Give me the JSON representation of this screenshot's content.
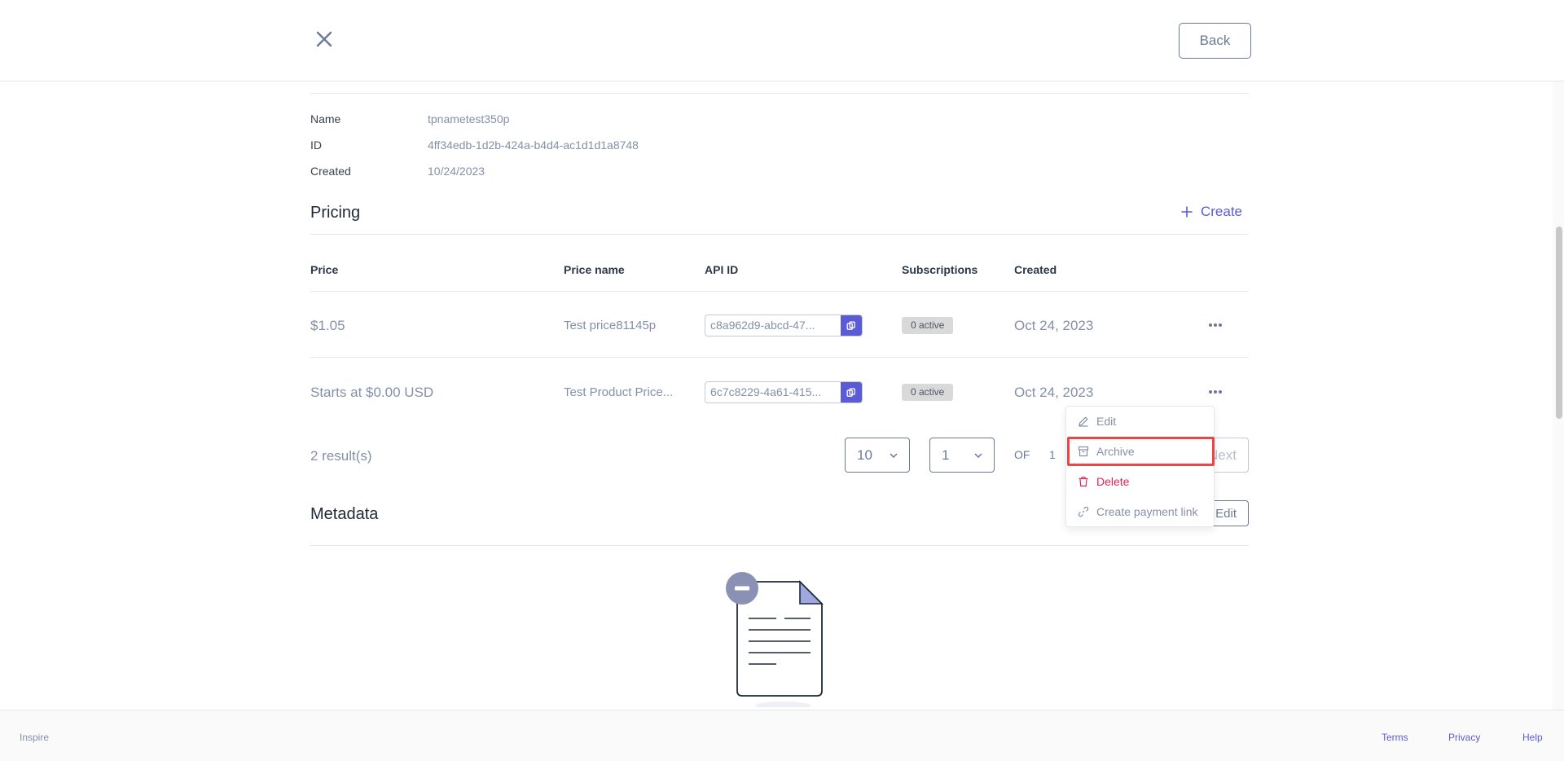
{
  "header": {
    "back_label": "Back"
  },
  "product": {
    "fields": [
      {
        "label": "Name",
        "value": "tpnametest350p"
      },
      {
        "label": "ID",
        "value": "4ff34edb-1d2b-424a-b4d4-ac1d1d1a8748"
      },
      {
        "label": "Created",
        "value": "10/24/2023"
      }
    ]
  },
  "pricing": {
    "title": "Pricing",
    "create_label": "Create",
    "columns": [
      "Price",
      "Price name",
      "API ID",
      "Subscriptions",
      "Created"
    ],
    "rows": [
      {
        "price": "$1.05",
        "name": "Test price81145p",
        "api_id": "c8a962d9-abcd-47...",
        "subs": "0 active",
        "created": "Oct 24, 2023"
      },
      {
        "price": "Starts at $0.00 USD",
        "name": "Test Product Price...",
        "api_id": "6c7c8229-4a61-415...",
        "subs": "0 active",
        "created": "Oct 24, 2023"
      }
    ],
    "results": "2 result(s)",
    "page_size": "10",
    "page": "1",
    "of_label": "OF",
    "total_pages": "1",
    "next_label": "Next"
  },
  "row_menu": {
    "items": [
      {
        "label": "Edit",
        "icon": "pencil-icon"
      },
      {
        "label": "Archive",
        "icon": "archive-icon"
      },
      {
        "label": "Delete",
        "icon": "trash-icon"
      },
      {
        "label": "Create payment link",
        "icon": "link-icon"
      }
    ]
  },
  "metadata": {
    "title": "Metadata",
    "edit_label": "Edit"
  },
  "footer": {
    "brand": "Inspire",
    "links": [
      "Terms",
      "Privacy",
      "Help"
    ]
  },
  "colors": {
    "accent": "#5b5bd6",
    "danger": "#dc2657",
    "highlight": "#ef4444"
  }
}
